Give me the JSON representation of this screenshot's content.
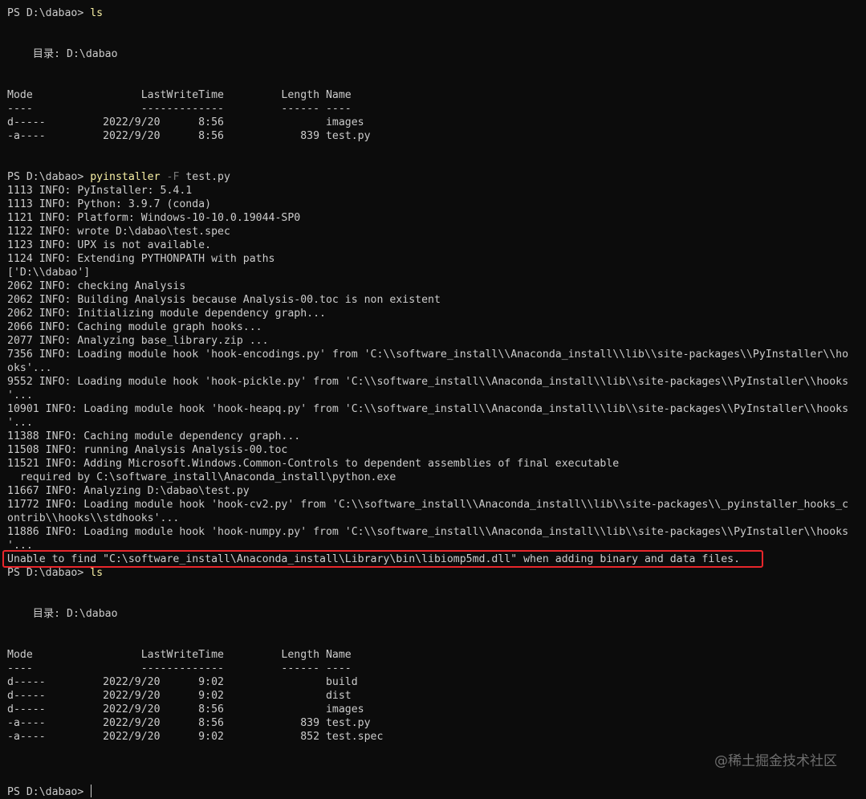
{
  "lines": [
    {
      "t": "prompt",
      "prompt": "PS D:\\dabao> ",
      "cmd": "ls",
      "args": ""
    },
    {
      "t": "blank"
    },
    {
      "t": "blank"
    },
    {
      "t": "text",
      "text": "    目录: D:\\dabao"
    },
    {
      "t": "blank"
    },
    {
      "t": "blank"
    },
    {
      "t": "text",
      "text": "Mode                 LastWriteTime         Length Name"
    },
    {
      "t": "text",
      "text": "----                 -------------         ------ ----"
    },
    {
      "t": "text",
      "text": "d-----         2022/9/20      8:56                images"
    },
    {
      "t": "text",
      "text": "-a----         2022/9/20      8:56            839 test.py"
    },
    {
      "t": "blank"
    },
    {
      "t": "blank"
    },
    {
      "t": "prompt",
      "prompt": "PS D:\\dabao> ",
      "cmd": "pyinstaller",
      "flag": " -F",
      "args": " test.py"
    },
    {
      "t": "text",
      "text": "1113 INFO: PyInstaller: 5.4.1"
    },
    {
      "t": "text",
      "text": "1113 INFO: Python: 3.9.7 (conda)"
    },
    {
      "t": "text",
      "text": "1121 INFO: Platform: Windows-10-10.0.19044-SP0"
    },
    {
      "t": "text",
      "text": "1122 INFO: wrote D:\\dabao\\test.spec"
    },
    {
      "t": "text",
      "text": "1123 INFO: UPX is not available."
    },
    {
      "t": "text",
      "text": "1124 INFO: Extending PYTHONPATH with paths"
    },
    {
      "t": "text",
      "text": "['D:\\\\dabao']"
    },
    {
      "t": "text",
      "text": "2062 INFO: checking Analysis"
    },
    {
      "t": "text",
      "text": "2062 INFO: Building Analysis because Analysis-00.toc is non existent"
    },
    {
      "t": "text",
      "text": "2062 INFO: Initializing module dependency graph..."
    },
    {
      "t": "text",
      "text": "2066 INFO: Caching module graph hooks..."
    },
    {
      "t": "text",
      "text": "2077 INFO: Analyzing base_library.zip ..."
    },
    {
      "t": "text",
      "text": "7356 INFO: Loading module hook 'hook-encodings.py' from 'C:\\\\software_install\\\\Anaconda_install\\\\lib\\\\site-packages\\\\PyInstaller\\\\ho"
    },
    {
      "t": "text",
      "text": "oks'..."
    },
    {
      "t": "text",
      "text": "9552 INFO: Loading module hook 'hook-pickle.py' from 'C:\\\\software_install\\\\Anaconda_install\\\\lib\\\\site-packages\\\\PyInstaller\\\\hooks"
    },
    {
      "t": "text",
      "text": "'..."
    },
    {
      "t": "text",
      "text": "10901 INFO: Loading module hook 'hook-heapq.py' from 'C:\\\\software_install\\\\Anaconda_install\\\\lib\\\\site-packages\\\\PyInstaller\\\\hooks"
    },
    {
      "t": "text",
      "text": "'..."
    },
    {
      "t": "text",
      "text": "11388 INFO: Caching module dependency graph..."
    },
    {
      "t": "text",
      "text": "11508 INFO: running Analysis Analysis-00.toc"
    },
    {
      "t": "text",
      "text": "11521 INFO: Adding Microsoft.Windows.Common-Controls to dependent assemblies of final executable"
    },
    {
      "t": "text",
      "text": "  required by C:\\software_install\\Anaconda_install\\python.exe"
    },
    {
      "t": "text",
      "text": "11667 INFO: Analyzing D:\\dabao\\test.py"
    },
    {
      "t": "text",
      "text": "11772 INFO: Loading module hook 'hook-cv2.py' from 'C:\\\\software_install\\\\Anaconda_install\\\\lib\\\\site-packages\\\\_pyinstaller_hooks_c"
    },
    {
      "t": "text",
      "text": "ontrib\\\\hooks\\\\stdhooks'..."
    },
    {
      "t": "text",
      "text": "11886 INFO: Loading module hook 'hook-numpy.py' from 'C:\\\\software_install\\\\Anaconda_install\\\\lib\\\\site-packages\\\\PyInstaller\\\\hooks"
    },
    {
      "t": "text",
      "text": "'..."
    },
    {
      "t": "error",
      "text": "Unable to find \"C:\\software_install\\Anaconda_install\\Library\\bin\\libiomp5md.dll\" when adding binary and data files."
    },
    {
      "t": "prompt",
      "prompt": "PS D:\\dabao> ",
      "cmd": "ls",
      "args": ""
    },
    {
      "t": "blank"
    },
    {
      "t": "blank"
    },
    {
      "t": "text",
      "text": "    目录: D:\\dabao"
    },
    {
      "t": "blank"
    },
    {
      "t": "blank"
    },
    {
      "t": "text",
      "text": "Mode                 LastWriteTime         Length Name"
    },
    {
      "t": "text",
      "text": "----                 -------------         ------ ----"
    },
    {
      "t": "text",
      "text": "d-----         2022/9/20      9:02                build"
    },
    {
      "t": "text",
      "text": "d-----         2022/9/20      9:02                dist"
    },
    {
      "t": "text",
      "text": "d-----         2022/9/20      8:56                images"
    },
    {
      "t": "text",
      "text": "-a----         2022/9/20      8:56            839 test.py"
    },
    {
      "t": "text",
      "text": "-a----         2022/9/20      9:02            852 test.spec"
    },
    {
      "t": "blank"
    },
    {
      "t": "blank"
    },
    {
      "t": "blank"
    },
    {
      "t": "prompt",
      "prompt": "PS D:\\dabao> ",
      "cmd": "",
      "args": "",
      "cursor": true
    }
  ],
  "watermark": "@稀土掘金技术社区",
  "colors": {
    "background": "#0c0c0c",
    "foreground": "#cccccc",
    "command": "#f9f1a5",
    "flag": "#767676",
    "highlight_box": "#e8262b"
  }
}
